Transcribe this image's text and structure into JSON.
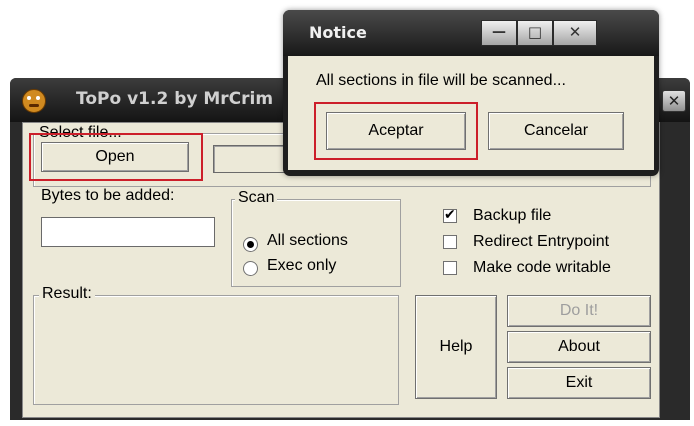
{
  "main_window": {
    "title": "ToPo v1.2 by MrCrim",
    "close_glyph": "✕"
  },
  "select_file": {
    "legend": "Select file...",
    "open_label": "Open",
    "path_value": ""
  },
  "bytes": {
    "label": "Bytes to be added:",
    "value": ""
  },
  "scan": {
    "legend": "Scan",
    "options": [
      {
        "label": "All sections",
        "selected": true
      },
      {
        "label": "Exec only",
        "selected": false
      }
    ]
  },
  "options": [
    {
      "label": "Backup file",
      "checked": true
    },
    {
      "label": "Redirect Entrypoint",
      "checked": false
    },
    {
      "label": "Make code writable",
      "checked": false
    }
  ],
  "result": {
    "legend": "Result:"
  },
  "buttons": {
    "help": "Help",
    "do_it": "Do It!",
    "about": "About",
    "exit": "Exit"
  },
  "notice": {
    "title": "Notice",
    "message": "All sections in file will be scanned...",
    "accept_label": "Aceptar",
    "cancel_label": "Cancelar",
    "minimize_glyph": "—",
    "maximize_glyph": "□",
    "close_glyph": "✕"
  },
  "icons": {
    "app": "topo-app-icon",
    "check": "✔"
  },
  "colors": {
    "highlight": "#cc1f2a",
    "dialog_face": "#ece9d8",
    "titlebar": "#1e1e1e"
  }
}
